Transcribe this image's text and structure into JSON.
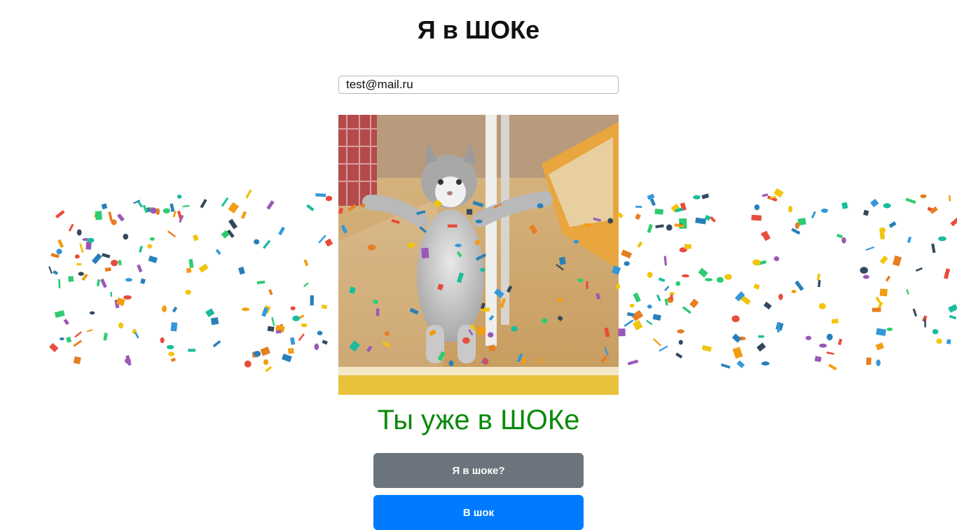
{
  "page": {
    "title": "Я в ШОКе",
    "email_value": "test@mail.ru",
    "status_text": "Ты уже в ШОКе",
    "status_color": "#0a8a0a"
  },
  "buttons": {
    "check_label": "Я в шоке?",
    "check_color": "#6c757d",
    "shock_label": "В шок",
    "shock_color": "#007bff"
  },
  "media": {
    "image": "kitten-shocked-gif",
    "overlay": "confetti"
  },
  "confetti_colors": [
    "#e74c3c",
    "#f1c40f",
    "#2ecc71",
    "#3498db",
    "#9b59b6",
    "#e67e22",
    "#1abc9c",
    "#34495e",
    "#f39c12",
    "#2980b9"
  ]
}
